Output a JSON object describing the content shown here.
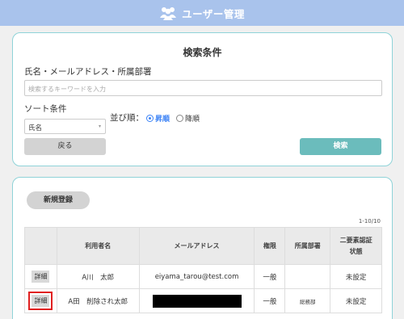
{
  "header": {
    "title": "ユーザー管理",
    "icon": "users-icon"
  },
  "search": {
    "title": "検索条件",
    "keyword_label": "氏名・メールアドレス・所属部署",
    "keyword_placeholder": "検索するキーワードを入力",
    "sort_label": "ソート条件",
    "sort_value": "氏名",
    "order_label": "並び順：",
    "order_options": [
      {
        "label": "昇順",
        "selected": true
      },
      {
        "label": "降順",
        "selected": false
      }
    ],
    "back_label": "戻る",
    "search_label": "検索"
  },
  "list": {
    "new_label": "新規登録",
    "count": "1-10/10",
    "columns": [
      "",
      "利用者名",
      "メールアドレス",
      "権限",
      "所属部署",
      "二要素認証\n状態"
    ],
    "rows": [
      {
        "detail": "詳細",
        "name": "A川　太郎",
        "email": "eiyama_tarou@test.com",
        "role": "一般",
        "dept": "",
        "twofa": "未設定"
      },
      {
        "detail": "詳細",
        "name": "A田　削除され太郎",
        "email": "",
        "role": "一般",
        "dept": "総務部",
        "twofa": "未設定"
      }
    ]
  },
  "colors": {
    "header": "#a9c3ec",
    "accent": "#6bbcbc",
    "card_border": "#8fd3d8",
    "highlight": "#e02020"
  }
}
